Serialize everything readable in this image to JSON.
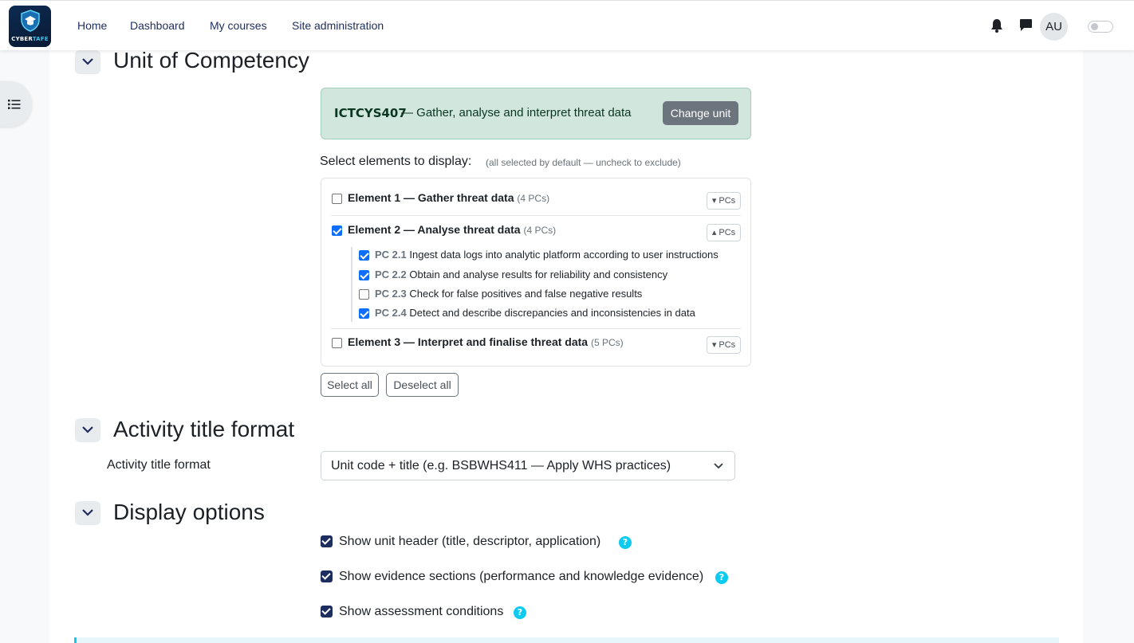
{
  "navbar": {
    "logo_text_a": "CYBER",
    "logo_text_b": "TAFE",
    "links": [
      "Home",
      "Dashboard",
      "My courses",
      "Site administration"
    ],
    "avatar_initials": "AU"
  },
  "sections": {
    "unit": {
      "title": "Unit of Competency",
      "unit_code": "ICTCYS407",
      "unit_name": "— Gather, analyse and interpret threat data",
      "change_button": "Change unit",
      "select_label": "Select elements to display:",
      "select_hint": "(all selected by default — uncheck to exclude)",
      "elements": [
        {
          "title": "Element 1 — Gather threat data",
          "count": "(4 PCs)",
          "checked": false,
          "toggle": "▾ PCs"
        },
        {
          "title": "Element 2 — Analyse threat data",
          "count": "(4 PCs)",
          "checked": true,
          "toggle": "▴ PCs"
        },
        {
          "title": "Element 3 — Interpret and finalise threat data",
          "count": "(5 PCs)",
          "checked": false,
          "toggle": "▾ PCs"
        }
      ],
      "pcs": [
        {
          "code": "PC 2.1",
          "text": "Ingest data logs into analytic platform according to user instructions",
          "checked": true
        },
        {
          "code": "PC 2.2",
          "text": "Obtain and analyse results for reliability and consistency",
          "checked": true
        },
        {
          "code": "PC 2.3",
          "text": "Check for false positives and false negative results",
          "checked": false
        },
        {
          "code": "PC 2.4",
          "text": "Detect and describe discrepancies and inconsistencies in data",
          "checked": true
        }
      ],
      "select_all": "Select all",
      "deselect_all": "Deselect all"
    },
    "activity": {
      "title": "Activity title format",
      "label": "Activity title format",
      "value": "Unit code + title (e.g. BSBWHS411 — Apply WHS practices)"
    },
    "display": {
      "title": "Display options",
      "options": [
        {
          "label": "Show unit header (title, descriptor, application)",
          "checked": true
        },
        {
          "label": "Show evidence sections (performance and knowledge evidence)",
          "checked": true
        },
        {
          "label": "Show assessment conditions",
          "checked": true
        }
      ],
      "help_glyph": "?"
    }
  },
  "colors": {
    "nav_text": "#1d2d5e",
    "unit_box_bg": "#d1e7dd",
    "checkbox_blue": "#0d6efd",
    "help_cyan": "#0dcaf0"
  }
}
